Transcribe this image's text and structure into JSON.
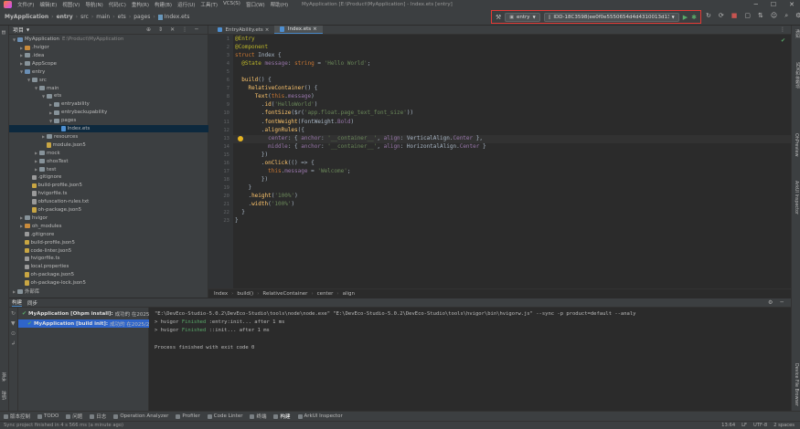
{
  "menu": {
    "items": [
      "文件(F)",
      "编辑(E)",
      "视图(V)",
      "导航(N)",
      "代码(C)",
      "重构(R)",
      "构建(B)",
      "运行(U)",
      "工具(T)",
      "VCS(S)",
      "窗口(W)",
      "帮助(H)"
    ],
    "window_title": "MyApplication [E:\\Product\\MyApplication] - Index.ets [entry]"
  },
  "navbar": {
    "crumbs": [
      "MyApplication",
      "entry",
      "src",
      "main",
      "ets",
      "pages",
      "Index.ets"
    ],
    "run_config": "entry",
    "device": "IDD-18C3598(ee0f0e5550654d4d4310013d13486a00)"
  },
  "project_panel": {
    "title": "项目",
    "tree": [
      {
        "depth": 0,
        "label": "MyApplication",
        "hint": "E:\\Product\\MyApplication",
        "icon": "folder-blue",
        "expanded": true
      },
      {
        "depth": 1,
        "label": ".hvigor",
        "icon": "folder-orange",
        "expanded": false
      },
      {
        "depth": 1,
        "label": ".idea",
        "icon": "folder",
        "expanded": false
      },
      {
        "depth": 1,
        "label": "AppScope",
        "icon": "folder",
        "expanded": false
      },
      {
        "depth": 1,
        "label": "entry",
        "icon": "folder-blue",
        "expanded": true
      },
      {
        "depth": 2,
        "label": "src",
        "icon": "folder",
        "expanded": true
      },
      {
        "depth": 3,
        "label": "main",
        "icon": "folder",
        "expanded": true
      },
      {
        "depth": 4,
        "label": "ets",
        "icon": "folder",
        "expanded": true
      },
      {
        "depth": 5,
        "label": "entryability",
        "icon": "folder",
        "expanded": false
      },
      {
        "depth": 5,
        "label": "entrybackupability",
        "icon": "folder",
        "expanded": false
      },
      {
        "depth": 5,
        "label": "pages",
        "icon": "folder",
        "expanded": true
      },
      {
        "depth": 6,
        "label": "Index.ets",
        "icon": "file-ets",
        "selected": true
      },
      {
        "depth": 4,
        "label": "resources",
        "icon": "folder",
        "expanded": false
      },
      {
        "depth": 4,
        "label": "module.json5",
        "icon": "file-json"
      },
      {
        "depth": 3,
        "label": "mock",
        "icon": "folder",
        "expanded": false
      },
      {
        "depth": 3,
        "label": "ohosTest",
        "icon": "folder",
        "expanded": false
      },
      {
        "depth": 3,
        "label": "test",
        "icon": "folder",
        "expanded": false
      },
      {
        "depth": 2,
        "label": ".gitignore",
        "icon": "file"
      },
      {
        "depth": 2,
        "label": "build-profile.json5",
        "icon": "file-json"
      },
      {
        "depth": 2,
        "label": "hvigorfile.ts",
        "icon": "file"
      },
      {
        "depth": 2,
        "label": "obfuscation-rules.txt",
        "icon": "file"
      },
      {
        "depth": 2,
        "label": "oh-package.json5",
        "icon": "file-json"
      },
      {
        "depth": 1,
        "label": "hvigor",
        "icon": "folder",
        "expanded": false
      },
      {
        "depth": 1,
        "label": "oh_modules",
        "icon": "folder-orange",
        "expanded": false
      },
      {
        "depth": 1,
        "label": ".gitignore",
        "icon": "file"
      },
      {
        "depth": 1,
        "label": "build-profile.json5",
        "icon": "file-json"
      },
      {
        "depth": 1,
        "label": "code-linter.json5",
        "icon": "file-json"
      },
      {
        "depth": 1,
        "label": "hvigorfile.ts",
        "icon": "file"
      },
      {
        "depth": 1,
        "label": "local.properties",
        "icon": "file"
      },
      {
        "depth": 1,
        "label": "oh-package.json5",
        "icon": "file-json"
      },
      {
        "depth": 1,
        "label": "oh-package-lock.json5",
        "icon": "file-json"
      },
      {
        "depth": 0,
        "label": "外部库",
        "icon": "folder",
        "expanded": false
      }
    ]
  },
  "editor": {
    "tabs": [
      {
        "label": "EntryAbility.ets",
        "active": false
      },
      {
        "label": "Index.ets",
        "active": true
      }
    ],
    "highlight_line": 13,
    "lines": [
      [
        [
          "deco",
          "@Entry"
        ]
      ],
      [
        [
          "deco",
          "@Component"
        ]
      ],
      [
        [
          "kw",
          "struct "
        ],
        [
          "",
          "Index {"
        ]
      ],
      [
        [
          "",
          "  "
        ],
        [
          "deco",
          "@State "
        ],
        [
          "prop",
          "message"
        ],
        [
          "",
          ": "
        ],
        [
          "kw",
          "string"
        ],
        [
          "",
          " = "
        ],
        [
          "str",
          "'Hello World'"
        ],
        [
          "",
          ";"
        ]
      ],
      [
        [
          "",
          ""
        ]
      ],
      [
        [
          "",
          "  "
        ],
        [
          "fn",
          "build"
        ],
        [
          "",
          "() {"
        ]
      ],
      [
        [
          "",
          "    "
        ],
        [
          "fn",
          "RelativeContainer"
        ],
        [
          "",
          "() {"
        ]
      ],
      [
        [
          "",
          "      "
        ],
        [
          "fn",
          "Text"
        ],
        [
          "",
          "("
        ],
        [
          "kw",
          "this"
        ],
        [
          "",
          "."
        ],
        [
          "prop",
          "message"
        ],
        [
          "",
          ")"
        ]
      ],
      [
        [
          "",
          "        ."
        ],
        [
          "fn",
          "id"
        ],
        [
          "",
          "("
        ],
        [
          "str",
          "'HelloWorld'"
        ],
        [
          "",
          ")"
        ]
      ],
      [
        [
          "",
          "        ."
        ],
        [
          "fn",
          "fontSize"
        ],
        [
          "",
          "($r("
        ],
        [
          "str",
          "'app.float.page_text_font_size'"
        ],
        [
          "",
          "))"
        ]
      ],
      [
        [
          "",
          "        ."
        ],
        [
          "fn",
          "fontWeight"
        ],
        [
          "",
          "(FontWeight."
        ],
        [
          "prop",
          "Bold"
        ],
        [
          "",
          ")"
        ]
      ],
      [
        [
          "",
          "        ."
        ],
        [
          "fn",
          "alignRules"
        ],
        [
          "",
          "({"
        ]
      ],
      [
        [
          "",
          "          "
        ],
        [
          "prop",
          "center"
        ],
        [
          "",
          ": { "
        ],
        [
          "prop",
          "anchor"
        ],
        [
          "",
          ": "
        ],
        [
          "str",
          "'__container__'"
        ],
        [
          "",
          ", "
        ],
        [
          "prop",
          "align"
        ],
        [
          "",
          ": VerticalAlign."
        ],
        [
          "prop",
          "Center"
        ],
        [
          "",
          " },"
        ]
      ],
      [
        [
          "",
          "          "
        ],
        [
          "prop",
          "middle"
        ],
        [
          "",
          ": { "
        ],
        [
          "prop",
          "anchor"
        ],
        [
          "",
          ": "
        ],
        [
          "str",
          "'__container__'"
        ],
        [
          "",
          ", "
        ],
        [
          "prop",
          "align"
        ],
        [
          "",
          ": HorizontalAlign."
        ],
        [
          "prop",
          "Center"
        ],
        [
          "",
          " }"
        ]
      ],
      [
        [
          "",
          "        })"
        ]
      ],
      [
        [
          "",
          "        ."
        ],
        [
          "fn",
          "onClick"
        ],
        [
          "",
          "(() => {"
        ]
      ],
      [
        [
          "",
          "          "
        ],
        [
          "kw",
          "this"
        ],
        [
          "",
          "."
        ],
        [
          "prop",
          "message"
        ],
        [
          "",
          " = "
        ],
        [
          "str",
          "'Welcome'"
        ],
        [
          "",
          ";"
        ]
      ],
      [
        [
          "",
          "        })"
        ]
      ],
      [
        [
          "",
          "    }"
        ]
      ],
      [
        [
          "",
          "    ."
        ],
        [
          "fn",
          "height"
        ],
        [
          "",
          "("
        ],
        [
          "str",
          "'100%'"
        ],
        [
          "",
          ")"
        ]
      ],
      [
        [
          "",
          "    ."
        ],
        [
          "fn",
          "width"
        ],
        [
          "",
          "("
        ],
        [
          "str",
          "'100%'"
        ],
        [
          "",
          ")"
        ]
      ],
      [
        [
          "",
          "  }"
        ]
      ],
      [
        [
          "",
          "}"
        ]
      ]
    ],
    "breadcrumb": [
      "Index",
      "build()",
      "RelativeContainer",
      "center",
      "align"
    ]
  },
  "build_panel": {
    "tabs": [
      "构建",
      "同步"
    ],
    "tree": [
      {
        "name": "MyApplication [Ohpm install]:",
        "desc": "成功的 在2025/2/",
        "selected": false
      },
      {
        "name": "MyApplication [build init]:",
        "desc": "成功的 在2025/2/19",
        "selected": true
      }
    ],
    "console": [
      "\"E:\\DevEco-Studio-5.0.2\\DevEco-Studio\\tools\\node\\node.exe\" \"E:\\DevEco-Studio-5.0.2\\DevEco-Studio\\tools\\hvigor\\bin\\hvigorw.js\" --sync -p product=default --analy",
      "> hvigor |Finished| :entry:init... after 1 ms",
      "> hvigor |Finished| ::init... after 1 ms",
      "",
      "Process finished with exit code 0"
    ]
  },
  "left_strip": [
    "书签",
    "结构"
  ],
  "right_strip": [
    "通知",
    "SDK和依赖项",
    "OhPreview",
    "ArkUI Inspector",
    "Device File Browser"
  ],
  "tool_windows": [
    {
      "label": "版本控制",
      "active": false
    },
    {
      "label": "TODO",
      "active": false
    },
    {
      "label": "问题",
      "active": false
    },
    {
      "label": "日志",
      "active": false
    },
    {
      "label": "Operation Analyzer",
      "active": false
    },
    {
      "label": "Profiler",
      "active": false
    },
    {
      "label": "Code Linter",
      "active": false
    },
    {
      "label": "终端",
      "active": false
    },
    {
      "label": "构建",
      "active": true
    },
    {
      "label": "ArkUI Inspector",
      "active": false
    }
  ],
  "status": {
    "message": "Sync project finished in 4 s 566 ms (a minute ago)",
    "position": "13:64",
    "line_sep": "LF",
    "encoding": "UTF-8",
    "indent": "2 spaces"
  },
  "colors": {
    "accent": "#4a88c7",
    "highlight_box": "#e53935",
    "run_green": "#59a869"
  }
}
